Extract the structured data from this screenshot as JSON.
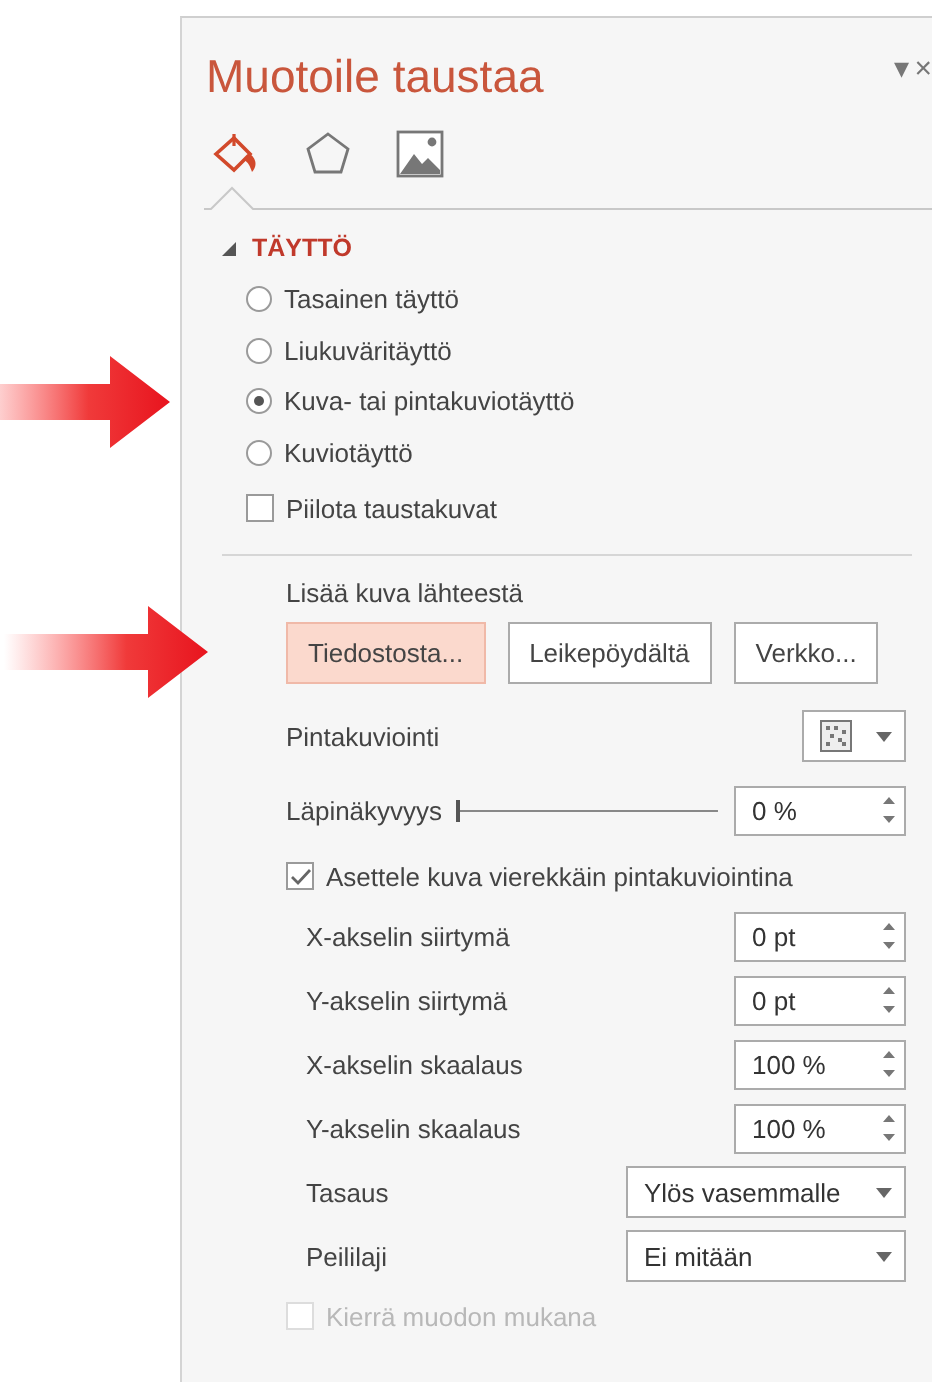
{
  "pane": {
    "title": "Muotoile taustaa",
    "menu_glyph": "▾",
    "close_glyph": "×"
  },
  "tabs": [
    {
      "kind": "fill",
      "selected": true
    },
    {
      "kind": "shape",
      "selected": false
    },
    {
      "kind": "picture",
      "selected": false
    }
  ],
  "section": {
    "title": "TÄYTTÖ",
    "expanded": true
  },
  "fill_options": [
    {
      "label": "Tasainen täyttö",
      "selected": false,
      "pointed": false
    },
    {
      "label": "Liukuväritäyttö",
      "selected": false,
      "pointed": false
    },
    {
      "label": "Kuva- tai pintakuviotäyttö",
      "selected": true,
      "pointed": true
    },
    {
      "label": "Kuviotäyttö",
      "selected": false,
      "pointed": false
    }
  ],
  "hide_background": {
    "label": "Piilota taustakuvat",
    "checked": false
  },
  "insert_from": {
    "label": "Lisää kuva lähteestä",
    "buttons": [
      {
        "label": "Tiedostosta...",
        "highlighted": true,
        "pointed": true
      },
      {
        "label": "Leikepöydältä",
        "highlighted": false,
        "pointed": false
      },
      {
        "label": "Verkko...",
        "highlighted": false,
        "pointed": false
      }
    ]
  },
  "texture": {
    "label": "Pintakuviointi"
  },
  "transparency": {
    "label": "Läpinäkyvyys",
    "level": 0,
    "value": "0 %"
  },
  "tile": {
    "label": "Asettele kuva vierekkäin pintakuviointina",
    "checked": true
  },
  "tile_fields": [
    {
      "kind": "spin",
      "label": "X-akselin siirtymä",
      "value": "0 pt"
    },
    {
      "kind": "spin",
      "label": "Y-akselin siirtymä",
      "value": "0 pt"
    },
    {
      "kind": "spin",
      "label": "X-akselin skaalaus",
      "value": "100 %"
    },
    {
      "kind": "spin",
      "label": "Y-akselin skaalaus",
      "value": "100 %"
    },
    {
      "kind": "dropdown",
      "label": "Tasaus",
      "value": "Ylös vasemmalle"
    },
    {
      "kind": "dropdown",
      "label": "Peililaji",
      "value": "Ei mitään"
    }
  ],
  "rotate": {
    "label": "Kierrä muodon mukana",
    "checked": false,
    "disabled": true
  }
}
